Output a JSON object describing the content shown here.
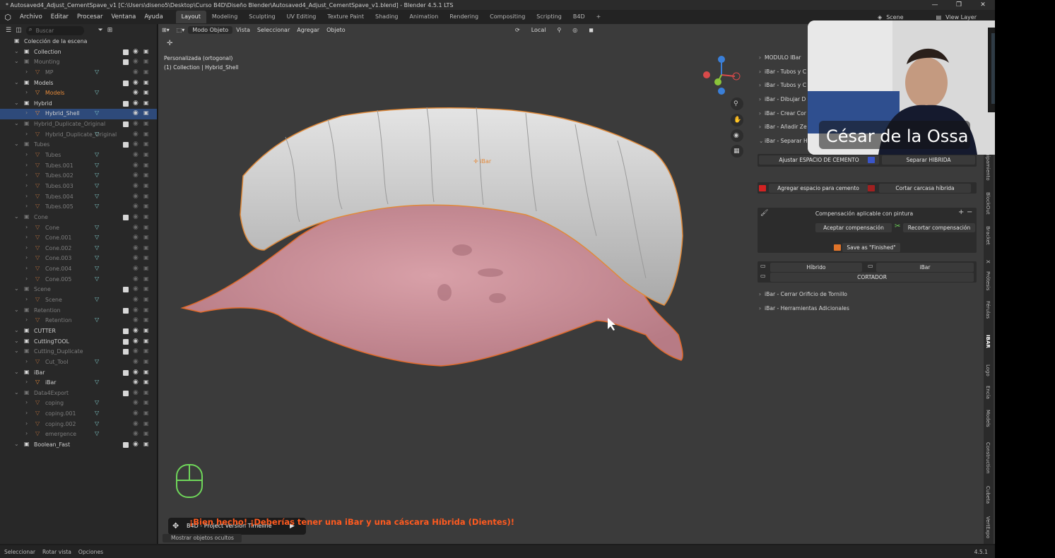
{
  "window": {
    "title": "* Autosaved4_Adjust_CementSpave_v1 [C:\\Users\\diseno5\\Desktop\\Curso B4D\\Diseño Blender\\Autosaved4_Adjust_CementSpave_v1.blend] - Blender 4.5.1 LTS",
    "controls": [
      "—",
      "❐",
      "✕"
    ]
  },
  "menu": [
    "Archivo",
    "Editar",
    "Procesar",
    "Ventana",
    "Ayuda"
  ],
  "workspaces": [
    "Layout",
    "Modeling",
    "Sculpting",
    "UV Editing",
    "Texture Paint",
    "Shading",
    "Animation",
    "Rendering",
    "Compositing",
    "Scripting",
    "B4D",
    "+"
  ],
  "topright": {
    "scene": "Scene",
    "view_layer": "View Layer"
  },
  "outliner": {
    "search_placeholder": "Buscar",
    "scene_collection": "Colección de la escena",
    "rows": [
      {
        "label": "Collection",
        "kind": "coll",
        "dim": false,
        "indent": 0
      },
      {
        "label": "Mounting",
        "kind": "coll",
        "dim": true,
        "indent": 0
      },
      {
        "label": "MP",
        "kind": "obj",
        "dim": true,
        "indent": 1
      },
      {
        "label": "Models",
        "kind": "coll",
        "dim": false,
        "indent": 0
      },
      {
        "label": "Models",
        "kind": "obj",
        "dim": false,
        "indent": 1,
        "orange": true
      },
      {
        "label": "Hybrid",
        "kind": "coll",
        "dim": false,
        "indent": 0
      },
      {
        "label": "Hybrid_Shell",
        "kind": "obj",
        "dim": false,
        "indent": 1,
        "selected": true
      },
      {
        "label": "Hybrid_Duplicate_Original",
        "kind": "coll",
        "dim": true,
        "indent": 0
      },
      {
        "label": "Hybrid_Duplicate_Original",
        "kind": "obj",
        "dim": true,
        "indent": 1
      },
      {
        "label": "Tubes",
        "kind": "coll",
        "dim": true,
        "indent": 0
      },
      {
        "label": "Tubes",
        "kind": "obj",
        "dim": true,
        "indent": 1
      },
      {
        "label": "Tubes.001",
        "kind": "obj",
        "dim": true,
        "indent": 1
      },
      {
        "label": "Tubes.002",
        "kind": "obj",
        "dim": true,
        "indent": 1
      },
      {
        "label": "Tubes.003",
        "kind": "obj",
        "dim": true,
        "indent": 1
      },
      {
        "label": "Tubes.004",
        "kind": "obj",
        "dim": true,
        "indent": 1
      },
      {
        "label": "Tubes.005",
        "kind": "obj",
        "dim": true,
        "indent": 1
      },
      {
        "label": "Cone",
        "kind": "coll",
        "dim": true,
        "indent": 0
      },
      {
        "label": "Cone",
        "kind": "obj",
        "dim": true,
        "indent": 1
      },
      {
        "label": "Cone.001",
        "kind": "obj",
        "dim": true,
        "indent": 1
      },
      {
        "label": "Cone.002",
        "kind": "obj",
        "dim": true,
        "indent": 1
      },
      {
        "label": "Cone.003",
        "kind": "obj",
        "dim": true,
        "indent": 1
      },
      {
        "label": "Cone.004",
        "kind": "obj",
        "dim": true,
        "indent": 1
      },
      {
        "label": "Cone.005",
        "kind": "obj",
        "dim": true,
        "indent": 1
      },
      {
        "label": "Scene",
        "kind": "coll",
        "dim": true,
        "indent": 0
      },
      {
        "label": "Scene",
        "kind": "obj",
        "dim": true,
        "indent": 1
      },
      {
        "label": "Retention",
        "kind": "coll",
        "dim": true,
        "indent": 0
      },
      {
        "label": "Retention",
        "kind": "obj",
        "dim": true,
        "indent": 1
      },
      {
        "label": "CUTTER",
        "kind": "coll",
        "dim": false,
        "indent": 0
      },
      {
        "label": "CuttingTOOL",
        "kind": "coll",
        "dim": false,
        "indent": 0
      },
      {
        "label": "Cutting_Duplicate",
        "kind": "coll",
        "dim": true,
        "indent": 0
      },
      {
        "label": "Cut_Tool",
        "kind": "obj",
        "dim": true,
        "indent": 1
      },
      {
        "label": "iBar",
        "kind": "coll",
        "dim": false,
        "indent": 0
      },
      {
        "label": "iBar",
        "kind": "obj",
        "dim": false,
        "indent": 1
      },
      {
        "label": "Data4Export",
        "kind": "coll",
        "dim": true,
        "indent": 0
      },
      {
        "label": "coping",
        "kind": "obj",
        "dim": true,
        "indent": 1
      },
      {
        "label": "coping.001",
        "kind": "obj",
        "dim": true,
        "indent": 1
      },
      {
        "label": "coping.002",
        "kind": "obj",
        "dim": true,
        "indent": 1
      },
      {
        "label": "emergence",
        "kind": "obj",
        "dim": true,
        "indent": 1
      },
      {
        "label": "Boolean_Fast",
        "kind": "coll",
        "dim": false,
        "indent": 0
      }
    ]
  },
  "viewport": {
    "header": [
      "Modo Objeto",
      "Vista",
      "Seleccionar",
      "Agregar",
      "Objeto"
    ],
    "transform_orientation": "Local",
    "view_name": "Personalizada (ortogonal)",
    "collection_info": "(1) Collection | Hybrid_Shell",
    "object_label": "iBar"
  },
  "npanel": {
    "sections": [
      "MODULO IBar",
      "iBar - Tubos y C",
      "iBar - Tubos y C",
      "iBar - Dibujar D",
      "iBar - Crear Cor",
      "iBar - Añadir Ze",
      "iBar - Separar H"
    ],
    "btn_adjust": "Ajustar ESPACIO DE CEMENTO",
    "btn_separate": "Separar HIBRIDA",
    "btn_add_space": "Agregar espacio para cemento",
    "btn_cut": "Cortar carcasa híbrida",
    "comp_title": "Compensación aplicable con pintura",
    "btn_accept": "Aceptar compensación",
    "btn_trim": "Recortar compensación",
    "btn_save": "Save as \"Finished\"",
    "btn_hibrido": "Híbrido",
    "btn_ibar": "iBar",
    "btn_cortador": "CORTADOR",
    "sec_screw": "iBar - Cerrar Orificio de Tornillo",
    "sec_tools": "iBar - Herramientas Adicionales"
  },
  "sidetabs": [
    "uipamiento",
    "BlockOut",
    "Bracket",
    "X",
    "Prótesis",
    "Férulas",
    "IBAR",
    "Logo",
    "Encía",
    "Models",
    "Construction",
    "Cubeta",
    "VertExpo"
  ],
  "webcam": {
    "name": "César de la Ossa"
  },
  "overlay": {
    "message": "¡Bien hecho! ¡Deberías tener una iBar y una cáscara Híbrida (Dientes)!",
    "tooltip": "B4D - Project Version Timeline",
    "hidden_objects": "Mostrar objetos ocultos"
  },
  "status": [
    "Seleccionar",
    "Rotar vista",
    "Opciones"
  ],
  "version": "4.5.1",
  "colors": {
    "accent": "#e58a3a",
    "selection": "#2e4a7a",
    "gum": "#c98a94",
    "teeth": "#cfcfcf",
    "message": "#ff5a1f"
  }
}
